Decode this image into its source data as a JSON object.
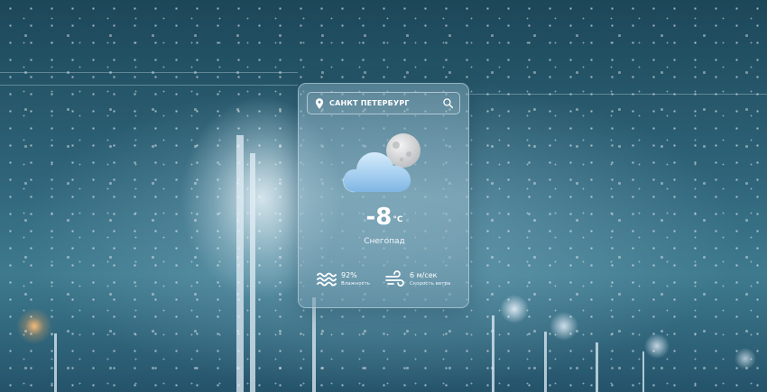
{
  "search": {
    "location": "САНКТ ПЕТЕРБУРГ",
    "pin_icon": "location-pin-icon",
    "search_icon": "search-icon"
  },
  "weather": {
    "icon": "cloud-with-moon-icon",
    "temperature": "-8",
    "unit": "°C",
    "condition": "Снегопад"
  },
  "stats": {
    "humidity": {
      "icon": "waves-icon",
      "value": "92%",
      "label": "Влажность"
    },
    "wind": {
      "icon": "wind-icon",
      "value": "6 м/сек",
      "label": "Скорость ветра"
    }
  },
  "colors": {
    "background": "#2f6479",
    "card_tint": "#96b9c8",
    "text": "#ffffff",
    "cloud": "#a9d2f2",
    "moon": "#d9dadb"
  }
}
